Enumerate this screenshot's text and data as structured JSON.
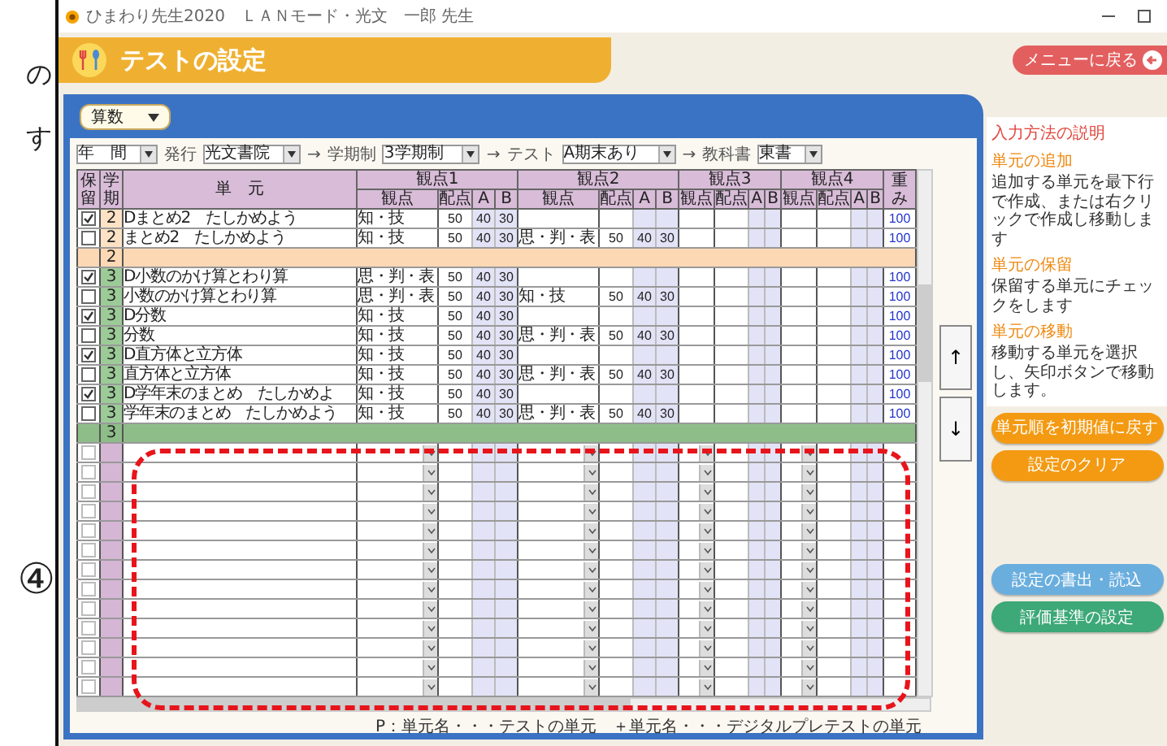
{
  "margin_texts": [
    "の",
    "す"
  ],
  "annotation": {
    "label": "④"
  },
  "window": {
    "title": "ひまわり先生2020　ＬＡＮモード・光文　一郎 先生"
  },
  "header": {
    "title": "テストの設定",
    "back_button": "メニューに戻る"
  },
  "subject": {
    "value": "算数"
  },
  "filters": [
    {
      "kind": "select",
      "value": "年　間"
    },
    {
      "kind": "label",
      "text": "発行"
    },
    {
      "kind": "select",
      "value": "光文書院"
    },
    {
      "kind": "arrow",
      "text": "→"
    },
    {
      "kind": "label",
      "text": "学期制"
    },
    {
      "kind": "select",
      "value": "3学期制"
    },
    {
      "kind": "arrow",
      "text": "→"
    },
    {
      "kind": "label",
      "text": "テスト"
    },
    {
      "kind": "select",
      "value": "A期末あり"
    },
    {
      "kind": "arrow",
      "text": "→"
    },
    {
      "kind": "label",
      "text": "教科書"
    },
    {
      "kind": "select",
      "value": "東書"
    }
  ],
  "table": {
    "header": {
      "hold": "保留",
      "term": "学期",
      "unit": "単　元",
      "weight": "重み",
      "groups": [
        {
          "title": "観点1",
          "columns": [
            "観点",
            "配点",
            "A",
            "B"
          ]
        },
        {
          "title": "観点2",
          "columns": [
            "観点",
            "配点",
            "A",
            "B"
          ]
        },
        {
          "title": "観点3",
          "columns": [
            "観点",
            "配点",
            "A",
            "B"
          ]
        },
        {
          "title": "観点4",
          "columns": [
            "観点",
            "配点",
            "A",
            "B"
          ]
        }
      ]
    },
    "rows": [
      {
        "kind": "unit",
        "checked": true,
        "term": "2",
        "color": "#fde2c6",
        "unit": "Dまとめ2　たしかめよう",
        "points": [
          {
            "view": "知・技",
            "score": "50",
            "a": "40",
            "b": "30"
          }
        ],
        "weight": "100"
      },
      {
        "kind": "unit",
        "checked": false,
        "term": "2",
        "color": "#fde2c6",
        "unit": "まとめ2　たしかめよう",
        "points": [
          {
            "view": "知・技",
            "score": "50",
            "a": "40",
            "b": "30"
          },
          {
            "view": "思・判・表",
            "score": "50",
            "a": "40",
            "b": "30"
          }
        ],
        "weight": "100"
      },
      {
        "kind": "separator",
        "term": "2",
        "color": "#fdd8b4"
      },
      {
        "kind": "unit",
        "checked": true,
        "term": "3",
        "color": "#9ccb98",
        "unit": "D小数のかけ算とわり算",
        "points": [
          {
            "view": "思・判・表",
            "score": "50",
            "a": "40",
            "b": "30"
          }
        ],
        "weight": "100"
      },
      {
        "kind": "unit",
        "checked": false,
        "term": "3",
        "color": "#9ccb98",
        "unit": "小数のかけ算とわり算",
        "points": [
          {
            "view": "思・判・表",
            "score": "50",
            "a": "40",
            "b": "30"
          },
          {
            "view": "知・技",
            "score": "50",
            "a": "40",
            "b": "30"
          }
        ],
        "weight": "100"
      },
      {
        "kind": "unit",
        "checked": true,
        "term": "3",
        "color": "#9ccb98",
        "unit": "D分数",
        "points": [
          {
            "view": "知・技",
            "score": "50",
            "a": "40",
            "b": "30"
          }
        ],
        "weight": "100"
      },
      {
        "kind": "unit",
        "checked": false,
        "term": "3",
        "color": "#9ccb98",
        "unit": "分数",
        "points": [
          {
            "view": "知・技",
            "score": "50",
            "a": "40",
            "b": "30"
          },
          {
            "view": "思・判・表",
            "score": "50",
            "a": "40",
            "b": "30"
          }
        ],
        "weight": "100"
      },
      {
        "kind": "unit",
        "checked": true,
        "term": "3",
        "color": "#9ccb98",
        "unit": "D直方体と立方体",
        "points": [
          {
            "view": "知・技",
            "score": "50",
            "a": "40",
            "b": "30"
          }
        ],
        "weight": "100"
      },
      {
        "kind": "unit",
        "checked": false,
        "term": "3",
        "color": "#9ccb98",
        "unit": "直方体と立方体",
        "points": [
          {
            "view": "知・技",
            "score": "50",
            "a": "40",
            "b": "30"
          },
          {
            "view": "思・判・表",
            "score": "50",
            "a": "40",
            "b": "30"
          }
        ],
        "weight": "100"
      },
      {
        "kind": "unit",
        "checked": true,
        "term": "3",
        "color": "#9ccb98",
        "unit": "D学年末のまとめ　たしかめよ",
        "points": [
          {
            "view": "知・技",
            "score": "50",
            "a": "40",
            "b": "30"
          }
        ],
        "weight": "100"
      },
      {
        "kind": "unit",
        "checked": false,
        "term": "3",
        "color": "#9ccb98",
        "unit": "学年末のまとめ　たしかめよう",
        "points": [
          {
            "view": "知・技",
            "score": "50",
            "a": "40",
            "b": "30"
          },
          {
            "view": "思・判・表",
            "score": "50",
            "a": "40",
            "b": "30"
          }
        ],
        "weight": "100"
      },
      {
        "kind": "separator",
        "term": "3",
        "color": "#8fbd89"
      },
      {
        "kind": "blank",
        "checked": false
      },
      {
        "kind": "blank",
        "checked": false
      },
      {
        "kind": "blank",
        "checked": false
      },
      {
        "kind": "blank",
        "checked": false
      },
      {
        "kind": "blank",
        "checked": false
      },
      {
        "kind": "blank",
        "checked": false
      },
      {
        "kind": "blank",
        "checked": false
      },
      {
        "kind": "blank",
        "checked": false
      },
      {
        "kind": "blank",
        "checked": false
      },
      {
        "kind": "blank",
        "checked": false
      },
      {
        "kind": "blank",
        "checked": false
      },
      {
        "kind": "blank",
        "checked": false
      },
      {
        "kind": "blank",
        "checked": false
      }
    ]
  },
  "move_buttons": [
    "↑",
    "↓"
  ],
  "legend": "P：単元名・・・テストの単元　＋単元名・・・デジタルプレテストの単元",
  "help": {
    "title": "入力方法の説明",
    "sections": [
      {
        "heading": "単元の追加",
        "text": "追加する単元を最下行で作成、または右クリックで作成し移動します"
      },
      {
        "heading": "単元の保留",
        "text": "保留する単元にチェックをします"
      },
      {
        "heading": "単元の移動",
        "text": "移動する単元を選択し、矢印ボタンで移動します。"
      }
    ]
  },
  "actions_top": [
    {
      "kind": "orange",
      "label": "単元順を初期値に戻す"
    },
    {
      "kind": "orange",
      "label": "設定のクリア"
    }
  ],
  "actions_bottom": [
    {
      "kind": "blue",
      "label": "設定の書出・読込"
    },
    {
      "kind": "green",
      "label": "評価基準の設定"
    }
  ]
}
